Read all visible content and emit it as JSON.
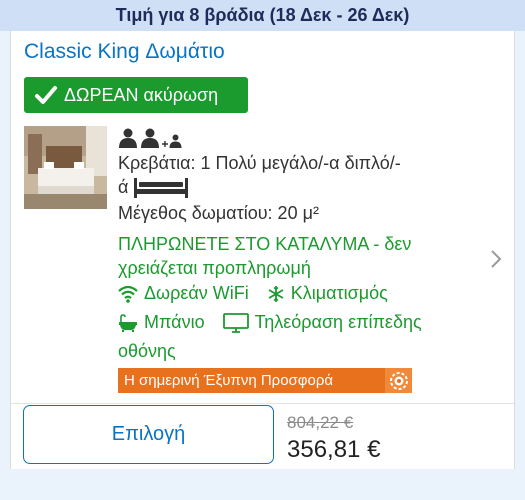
{
  "header": {
    "text": "Τιμή για 8 βράδια (18 Δεκ - 26 Δεκ)"
  },
  "room": {
    "title": "Classic King Δωμάτιο",
    "free_cancel": "ΔΩΡΕΑΝ ακύρωση",
    "beds_line1": "Κρεβάτια: 1 Πολύ μεγάλο/-α διπλό/-",
    "beds_line2": "ά",
    "size": "Μέγεθος δωματίου: 20 μ²",
    "pay_line1": "ΠΛΗΡΩΝΕΤΕ ΣΤΟ ΚΑΤΑΛΥΜΑ - δεν",
    "pay_line2": "χρειάζεται προπληρωμή",
    "amenities": {
      "wifi": "Δωρεάν WiFi",
      "ac": "Κλιματισμός",
      "bath": "Μπάνιο",
      "tv_line1": "Τηλεόραση επίπεδης",
      "tv_line2": "οθόνης"
    },
    "deal": "Η σημερινή Έξυπνη Προσφορά"
  },
  "action": {
    "select_label": "Επιλογή",
    "old_price": "804,22 €",
    "new_price": "356,81 €"
  },
  "colors": {
    "accent": "#0a74c4",
    "green": "#1b9a2e",
    "deal": "#e8711e",
    "header_bg": "#cfe0f6"
  },
  "icons": [
    "check-icon",
    "adult-icon",
    "child-icon",
    "bed-icon",
    "wifi-icon",
    "snowflake-icon",
    "bathtub-icon",
    "tv-icon",
    "chevron-right-icon",
    "deal-icon"
  ]
}
